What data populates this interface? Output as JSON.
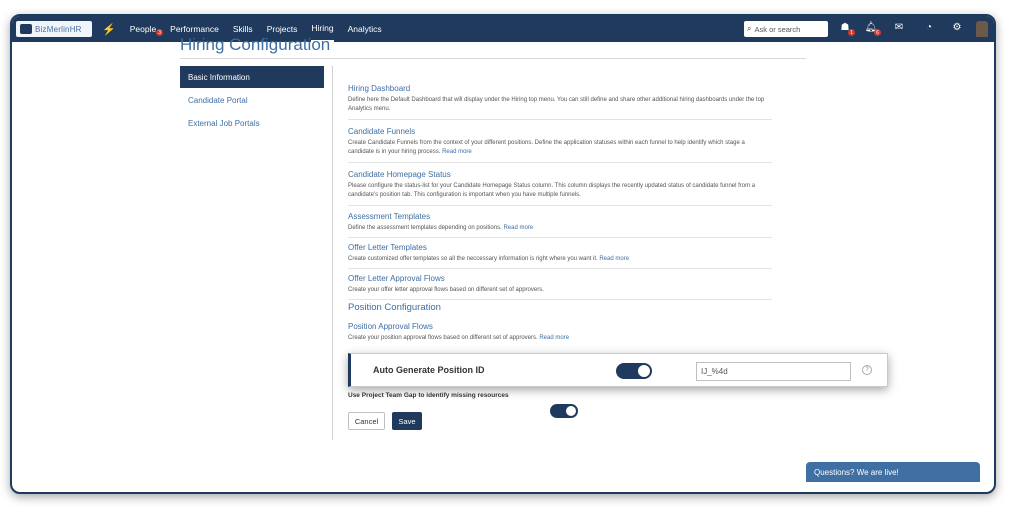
{
  "brand": {
    "logo_text": "BizMerlinHR"
  },
  "nav": {
    "items": [
      {
        "label": "People",
        "badge": "3"
      },
      {
        "label": "Performance"
      },
      {
        "label": "Skills"
      },
      {
        "label": "Projects"
      },
      {
        "label": "Hiring",
        "active": true
      },
      {
        "label": "Analytics"
      }
    ]
  },
  "search": {
    "placeholder": "Ask or search"
  },
  "top_icons": {
    "tasks_badge": "1",
    "notifications_badge": "6"
  },
  "page": {
    "title": "Hiring Configuration"
  },
  "leftnav": [
    "Basic Information",
    "Candidate Portal",
    "External Job Portals"
  ],
  "sections": [
    {
      "title": "Hiring Dashboard",
      "desc": "Define here the Default Dashboard that will display under the Hiring top menu. You can still define and share other additional hiring dashboards under the top Analytics menu.",
      "more": ""
    },
    {
      "title": "Candidate Funnels",
      "desc": "Create Candidate Funnels from the context of your different positions. Define the application statuses within each funnel to help identify which stage a candidate is in your hiring process.",
      "more": "Read more"
    },
    {
      "title": "Candidate Homepage Status",
      "desc": "Please configure the status-list for your Candidate Homepage Status column. This column displays the recently updated status of candidate funnel from a candidate's position tab. This configuration is important when you have multiple funnels.",
      "more": ""
    },
    {
      "title": "Assessment Templates",
      "desc": "Define the assessment templates depending on positions.",
      "more": "Read more"
    },
    {
      "title": "Offer Letter Templates",
      "desc": "Create customized offer templates so all the neccessary information is right where you want it.",
      "more": "Read more"
    },
    {
      "title": "Offer Letter Approval Flows",
      "desc": "Create your offer letter approval flows based on different set of approvers.",
      "more": ""
    }
  ],
  "position_config": {
    "heading": "Position Configuration",
    "approval": {
      "title": "Position Approval Flows",
      "desc": "Create your position approval flows based on different set of approvers.",
      "more": "Read more"
    },
    "auto_id": {
      "label": "Auto Generate Position ID",
      "enabled": true,
      "value": "IJ_%4d"
    },
    "team_gap": {
      "label": "Use Project Team Gap to identify missing resources",
      "enabled": true
    }
  },
  "buttons": {
    "cancel": "Cancel",
    "save": "Save"
  },
  "chat": {
    "label": "Questions? We are live!"
  }
}
